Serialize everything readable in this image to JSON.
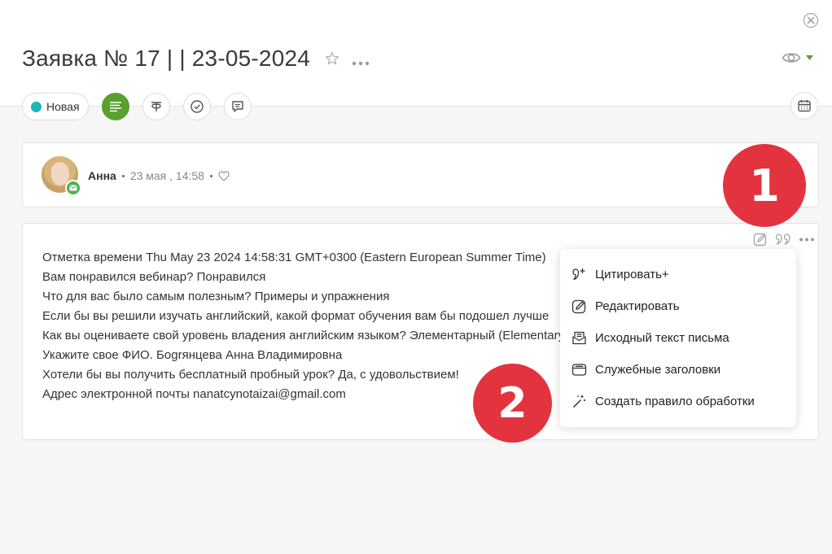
{
  "header": {
    "title": "Заявка № 17 | | 23-05-2024"
  },
  "toolbar": {
    "status_label": "Новая",
    "status_color": "#1db5b9",
    "active_color": "#5aa02c"
  },
  "author": {
    "name": "Анна",
    "date": "23 мая , 14:58"
  },
  "message": {
    "lines": [
      "Отметка времени Thu May 23 2024 14:58:31 GMT+0300 (Eastern European Summer Time)",
      "Вам понравился вебинар? Понравился",
      "Что для вас было самым полезным? Примеры и упражнения",
      "Если бы вы решили изучать английский, какой формат обучения вам бы подошел лучше",
      "Как вы оцениваете свой уровень владения английским языком? Элементарный (Elementary)",
      "Укажите свое ФИО. Бogrянцева Анна Владимировна",
      "Хотели бы вы получить бесплатный пробный урок? Да, с удовольствием!",
      "Адрес электронной почты nanatcynotaizai@gmail.com"
    ]
  },
  "menu": {
    "items": [
      {
        "label": "Цитировать+",
        "icon": "quote-plus-icon"
      },
      {
        "label": "Редактировать",
        "icon": "edit-icon"
      },
      {
        "label": "Исходный текст письма",
        "icon": "envelope-source-icon"
      },
      {
        "label": "Служебные заголовки",
        "icon": "headers-icon"
      },
      {
        "label": "Создать правило обработки",
        "icon": "magic-wand-icon"
      }
    ]
  },
  "markers": {
    "one": "1",
    "two": "2",
    "color": "#e3333f"
  }
}
